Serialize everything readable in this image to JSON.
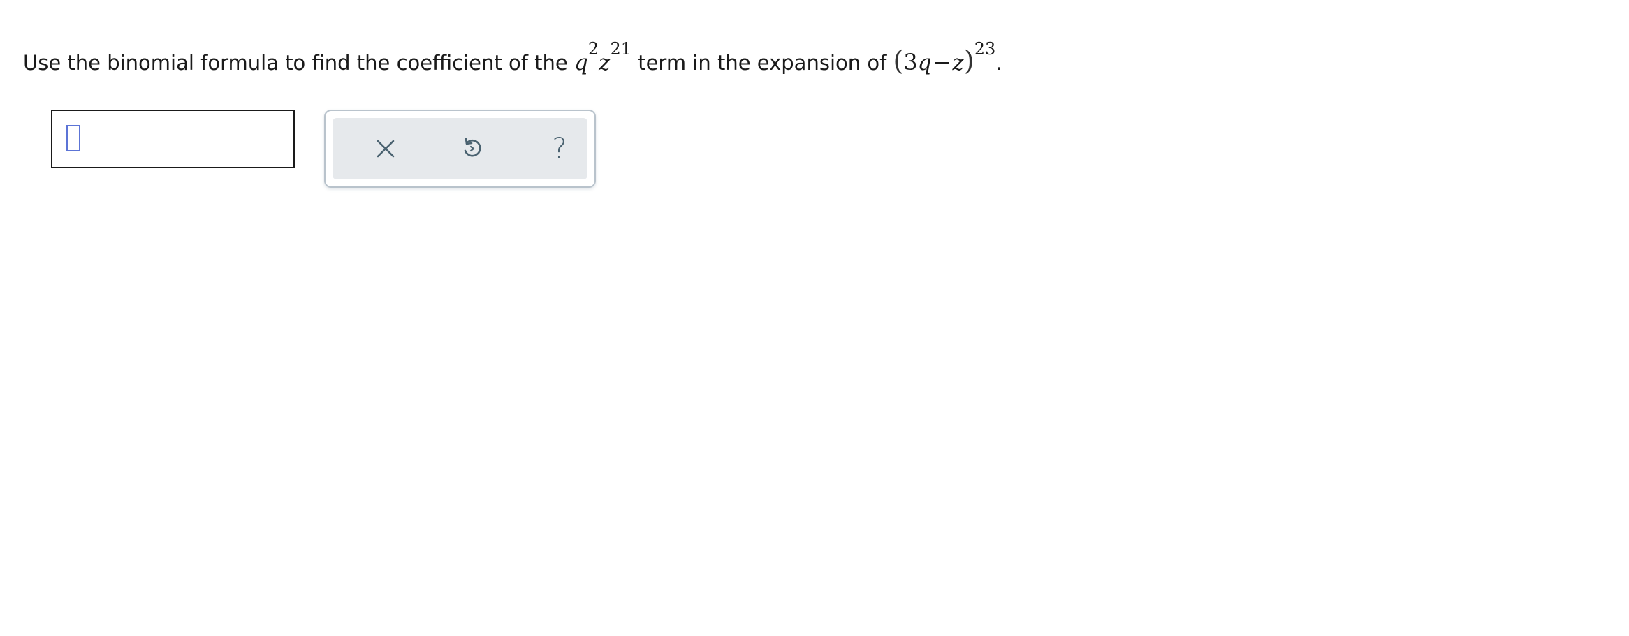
{
  "question": {
    "prefix": "Use the binomial formula to find the coefficient of the",
    "term": {
      "var1": "q",
      "exp1": "2",
      "var2": "z",
      "exp2": "21"
    },
    "middle": "term in the expansion of",
    "expression": {
      "open_paren": "(",
      "coef": "3",
      "var1": "q",
      "minus": "−",
      "var2": "z",
      "close_paren": ")",
      "exponent": "23"
    },
    "suffix": "."
  },
  "answer": {
    "value": ""
  },
  "toolbar": {
    "clear_icon": "close-icon",
    "undo_icon": "undo-icon",
    "help_label": "?"
  },
  "colors": {
    "caret_border": "#5c74d6",
    "toolbar_bg": "#e6e9ec",
    "icon_color": "#4a6270"
  }
}
